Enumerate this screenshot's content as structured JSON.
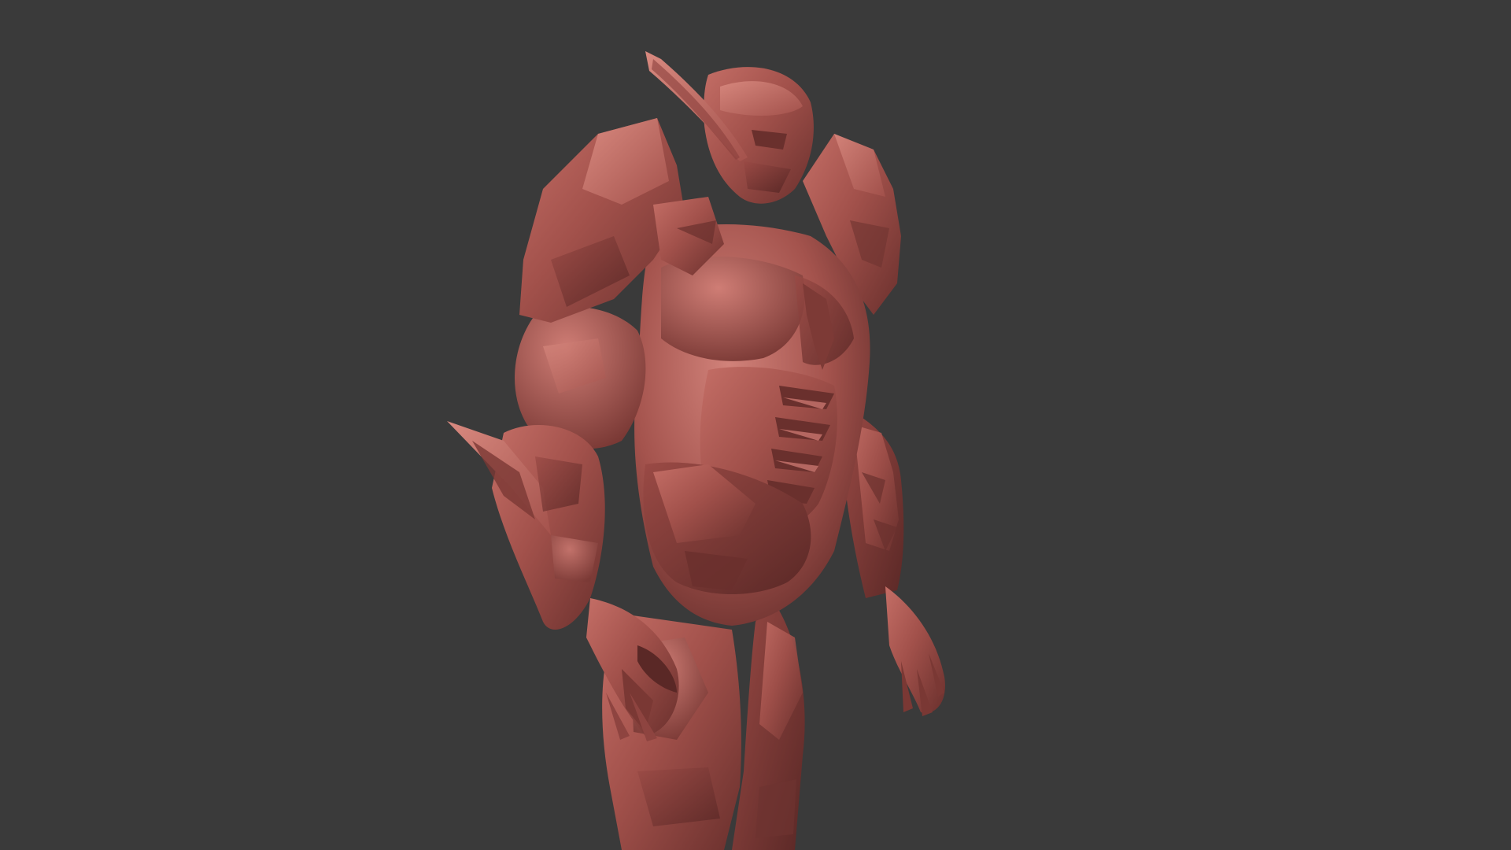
{
  "viewport": {
    "background": "#3a3a3a",
    "model": {
      "name": "armored-humanoid-sculpt",
      "material_base": "#8e4440",
      "material_highlight": "#c9746c",
      "material_shadow": "#4e2422",
      "parts": [
        "head",
        "head-horn",
        "left-pauldron",
        "right-pauldron",
        "torso",
        "abdomen-ribs",
        "left-upper-arm",
        "left-forearm-gauntlet",
        "left-hand",
        "right-arm",
        "right-hand",
        "waist-armor",
        "left-leg",
        "right-leg"
      ]
    }
  }
}
